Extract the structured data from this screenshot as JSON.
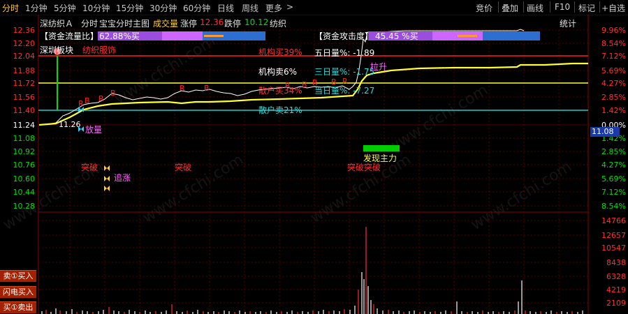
{
  "toolbar": {
    "timeframes": [
      "分时",
      "1分钟",
      "5分钟",
      "10分钟",
      "15分钟",
      "30分钟",
      "60分钟",
      "日线",
      "周线",
      "更多"
    ],
    "active": "分时",
    "more_chevron": ">",
    "right_tools": [
      "竞价",
      "叠加",
      "画线",
      "F10",
      "标记",
      "+自选"
    ]
  },
  "info_bar": {
    "stock_name": "深纺织Ａ",
    "mode": "分时",
    "template": "宝宝分时主图",
    "volume_label": "成交量",
    "limit_up_label": "涨停",
    "limit_up_value": "12.36",
    "limit_down_label": "跌停",
    "limit_down_value": "10.12",
    "sector": "纺织",
    "stats_label": "统计"
  },
  "price_axis": [
    "12.36",
    "12.20",
    "12.04",
    "11.88",
    "11.72",
    "11.56",
    "11.40",
    "11.24",
    "11.08",
    "10.92",
    "10.76",
    "10.60",
    "10.44",
    "10.28"
  ],
  "pct_axis": [
    "9.96%",
    "8.54%",
    "7.12%",
    "5.69%",
    "4.27%",
    "2.85%",
    "1.42%",
    "0.00%",
    "1.42%",
    "2.85%",
    "4.27%",
    "5.69%",
    "7.12%",
    "8.54%"
  ],
  "volume_axis": [
    "14766",
    "12657",
    "10547",
    "8438",
    "6328",
    "4219",
    "2109"
  ],
  "current_price": "11.08",
  "indicators": {
    "flow_label": "【资金流量比】",
    "flow_value": "62.88%买",
    "attack_label": "【资金攻击度】",
    "attack_value": "45.45 %买",
    "inst_buy": "机构买39%",
    "inst_sell": "机构卖6%",
    "retail_buy": "散户买34%",
    "retail_sell": "散户卖21%",
    "five_day": "五日量%: -1.89",
    "three_day": "三日量%: -1.75",
    "today": "当日量%: -7.27",
    "open_price": "11.26",
    "stock_tag": "深圳板块",
    "industry": "纺织服饰",
    "surge": "拉升",
    "shrink": "放量",
    "chase": "追涨",
    "breakthrough1": "突破",
    "breakthrough2": "突破",
    "breakthrough3": "突破突破",
    "main_force": "发现主力",
    "marker_r": "R",
    "marker_b": "B"
  },
  "watermark": "www.cfchi.com",
  "buttons": [
    "卖①买入",
    "闪电买入",
    "买①卖出"
  ],
  "colors": {
    "up": "#ff3030",
    "down": "#00e000",
    "price_line": "#ffffff",
    "avg_line": "#ffff33",
    "grid": "#5a0000",
    "axis_text": "#ff3030",
    "purple": "#9b4de0",
    "blue": "#2c6fd1"
  }
}
